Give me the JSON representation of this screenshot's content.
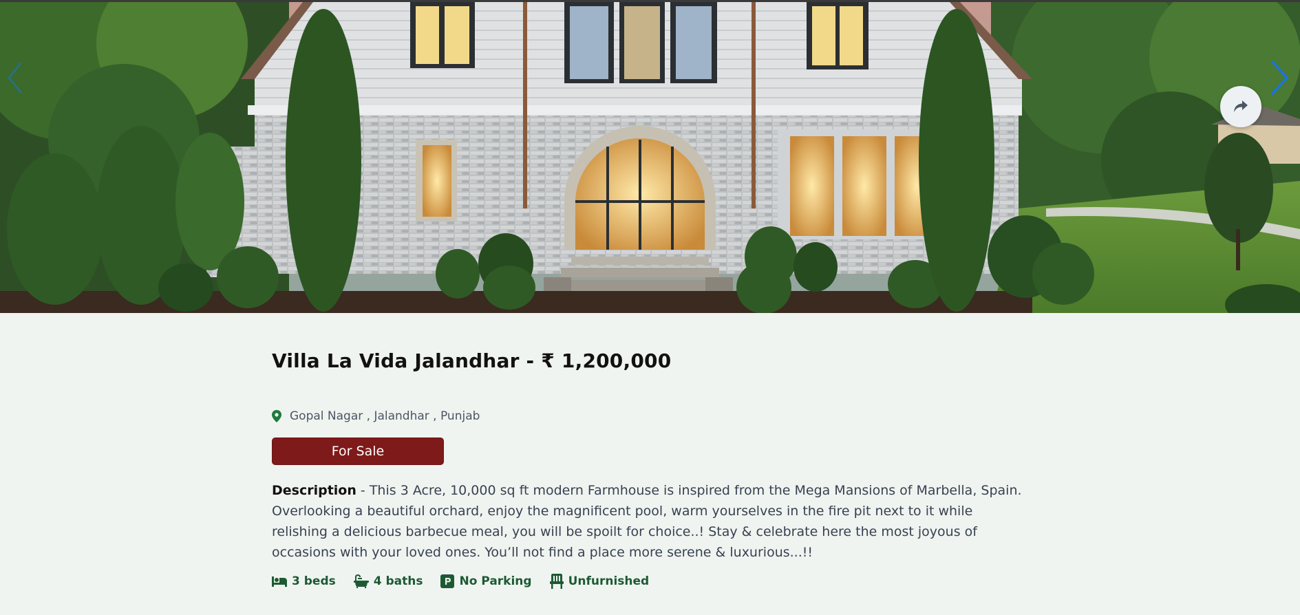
{
  "carousel": {
    "prev_icon": "chevron-left-icon",
    "next_icon": "chevron-right-icon",
    "share_icon": "share-icon",
    "image_alt": "Villa exterior"
  },
  "property": {
    "title": "Villa La Vida Jalandhar - ₹ 1,200,000",
    "location": "Gopal Nagar , Jalandhar , Punjab",
    "status": "For Sale",
    "description_label": "Description",
    "description_text": " - This 3 Acre, 10,000 sq ft modern Farmhouse is inspired from the Mega Mansions of Marbella, Spain. Overlooking a beautiful orchard, enjoy the magnificent pool, warm yourselves in the fire pit next to it while relishing a delicious barbecue meal, you will be spoilt for choice..! Stay & celebrate here the most joyous of occasions with your loved ones. You’ll not find a place more serene & luxurious...!!",
    "features": {
      "beds": "3 beds",
      "baths": "4 baths",
      "parking": "No Parking",
      "furnishing": "Unfurnished"
    }
  },
  "colors": {
    "accent_green": "#1d5a34",
    "status_red": "#7f1a1a",
    "arrow_blue": "#1a73e8",
    "page_bg": "#f0f4f0"
  }
}
